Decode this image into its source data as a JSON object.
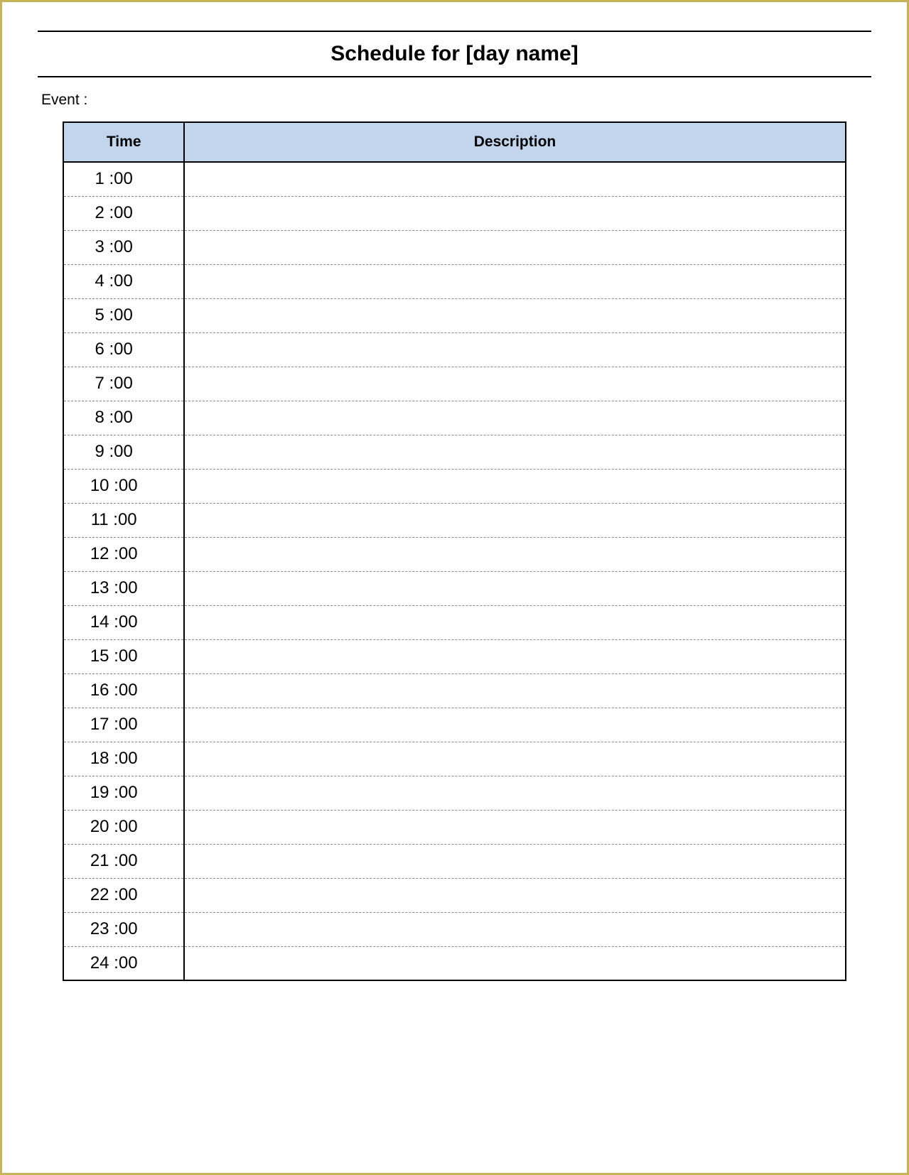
{
  "header": {
    "title": "Schedule for [day name]"
  },
  "event_label": "Event :",
  "table": {
    "headers": {
      "time": "Time",
      "description": "Description"
    },
    "rows": [
      {
        "time": "1 :00",
        "description": ""
      },
      {
        "time": "2 :00",
        "description": ""
      },
      {
        "time": "3 :00",
        "description": ""
      },
      {
        "time": "4 :00",
        "description": ""
      },
      {
        "time": "5 :00",
        "description": ""
      },
      {
        "time": "6 :00",
        "description": ""
      },
      {
        "time": "7 :00",
        "description": ""
      },
      {
        "time": "8 :00",
        "description": ""
      },
      {
        "time": "9 :00",
        "description": ""
      },
      {
        "time": "10 :00",
        "description": ""
      },
      {
        "time": "11 :00",
        "description": ""
      },
      {
        "time": "12 :00",
        "description": ""
      },
      {
        "time": "13 :00",
        "description": ""
      },
      {
        "time": "14 :00",
        "description": ""
      },
      {
        "time": "15 :00",
        "description": ""
      },
      {
        "time": "16 :00",
        "description": ""
      },
      {
        "time": "17 :00",
        "description": ""
      },
      {
        "time": "18 :00",
        "description": ""
      },
      {
        "time": "19 :00",
        "description": ""
      },
      {
        "time": "20 :00",
        "description": ""
      },
      {
        "time": "21 :00",
        "description": ""
      },
      {
        "time": "22 :00",
        "description": ""
      },
      {
        "time": "23 :00",
        "description": ""
      },
      {
        "time": "24 :00",
        "description": ""
      }
    ]
  }
}
